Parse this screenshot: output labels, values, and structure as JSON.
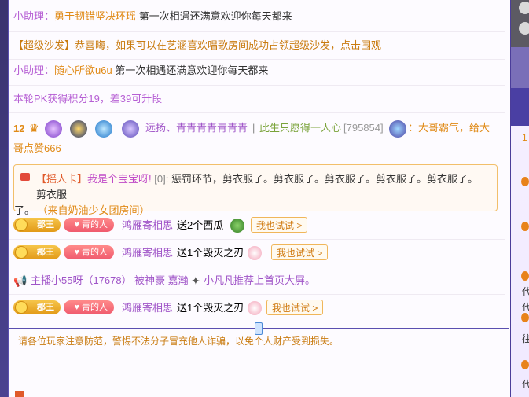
{
  "chat": {
    "msg1": {
      "prefix": "小助理：",
      "name": "勇于韧错坚决环瑶",
      "text": " 第一次相遇还满意欢迎你每天都来"
    },
    "msg2": {
      "text": "【超级沙发】恭喜晦，如果可以在艺涵喜欢唱歌房间成功占领超级沙发，点击围观"
    },
    "msg3": {
      "prefix": "小助理：",
      "name": "随心所欲u6u",
      "text": " 第一次相遇还满意欢迎你每天都来"
    },
    "msg4": {
      "text": "本轮PK获得积分19，差39可升段"
    },
    "msg5": {
      "level": "12",
      "names": "远扬、青青青青青青青",
      "sep": "|",
      "sign": "此生只愿得一人心",
      "id": "[795854]",
      "tail": "：大哥霸气，给大",
      "tail2": "哥点赞666"
    },
    "card": {
      "label": "【摇人卡】",
      "name": "我是个宝宝呀!",
      "code": " [0]:",
      "text": " 惩罚环节，剪衣服了。剪衣服了。剪衣服了。剪衣服了。剪衣服了。剪衣服",
      "text2": "了。",
      "source": "（来自奶油少女团房间）"
    },
    "gifts": [
      {
        "badge1": "郡王",
        "badge2": "青的人",
        "user": "鸿雁寄相思",
        "text": "送2个西瓜",
        "button": "我也试试 >"
      },
      {
        "badge1": "郡王",
        "badge2": "青的人",
        "user": "鸿雁寄相思",
        "text": "送1个毁灭之刃",
        "button": "我也试试 >"
      },
      {
        "badge1": "郡王",
        "badge2": "青的人",
        "user": "鸿雁寄相思",
        "text": "送1个毁灭之刃",
        "button": "我也试试 >"
      }
    ],
    "recommend": {
      "host": "主播小55呀（17678）",
      "user": "被神豪 嘉瀚",
      "target": "小凡凡",
      "text": " 推荐上首页大屏。"
    }
  },
  "notice": "请各位玩家注意防范，警惕不法分子冒充他人诈骗，以免个人财产受到损失。",
  "sidebar": {
    "num": "1",
    "labels": [
      "代",
      "代",
      "往",
      "代"
    ]
  },
  "colors": {
    "accent": "#5b4fb0",
    "helper": "#b65fd4",
    "gold": "#e08a16"
  }
}
